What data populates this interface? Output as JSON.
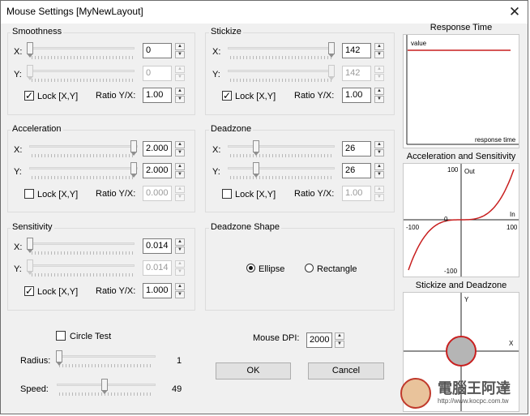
{
  "window": {
    "title": "Mouse Settings [MyNewLayout]",
    "close_glyph": "✕"
  },
  "smoothness": {
    "title": "Smoothness",
    "x_label": "X:",
    "x_value": "0",
    "y_label": "Y:",
    "y_value": "0",
    "lock_label": "Lock [X,Y]",
    "lock_checked": true,
    "ratio_label": "Ratio Y/X:",
    "ratio_value": "1.00"
  },
  "stickize": {
    "title": "Stickize",
    "x_label": "X:",
    "x_value": "142",
    "y_label": "Y:",
    "y_value": "142",
    "lock_label": "Lock [X,Y]",
    "lock_checked": true,
    "ratio_label": "Ratio Y/X:",
    "ratio_value": "1.00"
  },
  "acceleration": {
    "title": "Acceleration",
    "x_label": "X:",
    "x_value": "2.000",
    "y_label": "Y:",
    "y_value": "2.000",
    "lock_label": "Lock [X,Y]",
    "lock_checked": false,
    "ratio_label": "Ratio Y/X:",
    "ratio_value": "0.000"
  },
  "deadzone": {
    "title": "Deadzone",
    "x_label": "X:",
    "x_value": "26",
    "y_label": "Y:",
    "y_value": "26",
    "lock_label": "Lock [X,Y]",
    "lock_checked": false,
    "ratio_label": "Ratio Y/X:",
    "ratio_value": "1.00"
  },
  "sensitivity": {
    "title": "Sensitivity",
    "x_label": "X:",
    "x_value": "0.014",
    "y_label": "Y:",
    "y_value": "0.014",
    "lock_label": "Lock [X,Y]",
    "lock_checked": true,
    "ratio_label": "Ratio Y/X:",
    "ratio_value": "1.000"
  },
  "deadzone_shape": {
    "title": "Deadzone Shape",
    "ellipse_label": "Ellipse",
    "rectangle_label": "Rectangle",
    "selected": "Ellipse"
  },
  "circle_test": {
    "label": "Circle Test",
    "checked": false,
    "radius_label": "Radius:",
    "radius_value": "1",
    "speed_label": "Speed:",
    "speed_value": "49"
  },
  "dpi": {
    "label": "Mouse DPI:",
    "value": "2000"
  },
  "buttons": {
    "ok": "OK",
    "cancel": "Cancel"
  },
  "graphs": {
    "response_time": {
      "title": "Response Time",
      "value_label": "value",
      "axis_label": "response time"
    },
    "accel_sensitivity": {
      "title": "Acceleration and Sensitivity",
      "y_top": "100",
      "y_label": "Out",
      "origin": "0",
      "x_left": "-100",
      "x_right": "100",
      "x_label": "In",
      "y_bottom": "-100"
    },
    "stickize_deadzone": {
      "title": "Stickize and Deadzone",
      "y_label": "Y",
      "x_label": "X"
    }
  },
  "watermark": {
    "site_text": "電腦王阿達",
    "url": "http://www.kocpc.com.tw"
  },
  "colors": {
    "curve": "#c0392b",
    "accent_red": "#c81f1f",
    "deadzone_fill": "#b5b5b5"
  }
}
